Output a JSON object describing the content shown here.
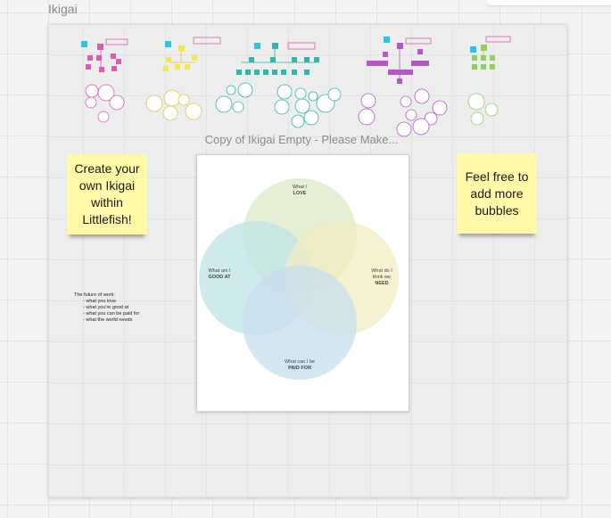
{
  "frame": {
    "title": "Ikigai"
  },
  "board": {
    "title": "Copy of Ikigai Empty - Please Make..."
  },
  "sticky_left": "Create your own Ikigai within Littlefish!",
  "sticky_right": "Feel free to add more bubbles",
  "venn": {
    "love": {
      "line1": "What I",
      "line2": "LOVE"
    },
    "good": {
      "line1": "What am I",
      "line2": "GOOD AT"
    },
    "need": {
      "line1": "What do I",
      "line1b": "think we",
      "line2": "NEED"
    },
    "paid": {
      "line1": "What can I be",
      "line2": "PAID FOR"
    }
  },
  "note": {
    "heading": "The future of work:",
    "items": [
      "what you love",
      "what you're good at",
      "what you can be paid for",
      "what the world needs"
    ]
  },
  "colors": {
    "love": "#dce9c6",
    "good": "#bfe3e7",
    "need": "#f2ecc2",
    "paid": "#c7ddef",
    "sticky": "#fff9a8",
    "pink": "#e05ab2",
    "cyan": "#29c4e8",
    "yellow": "#f1e84a",
    "teal": "#2bb8b0",
    "purple": "#b557c9",
    "green": "#8fd15a"
  }
}
